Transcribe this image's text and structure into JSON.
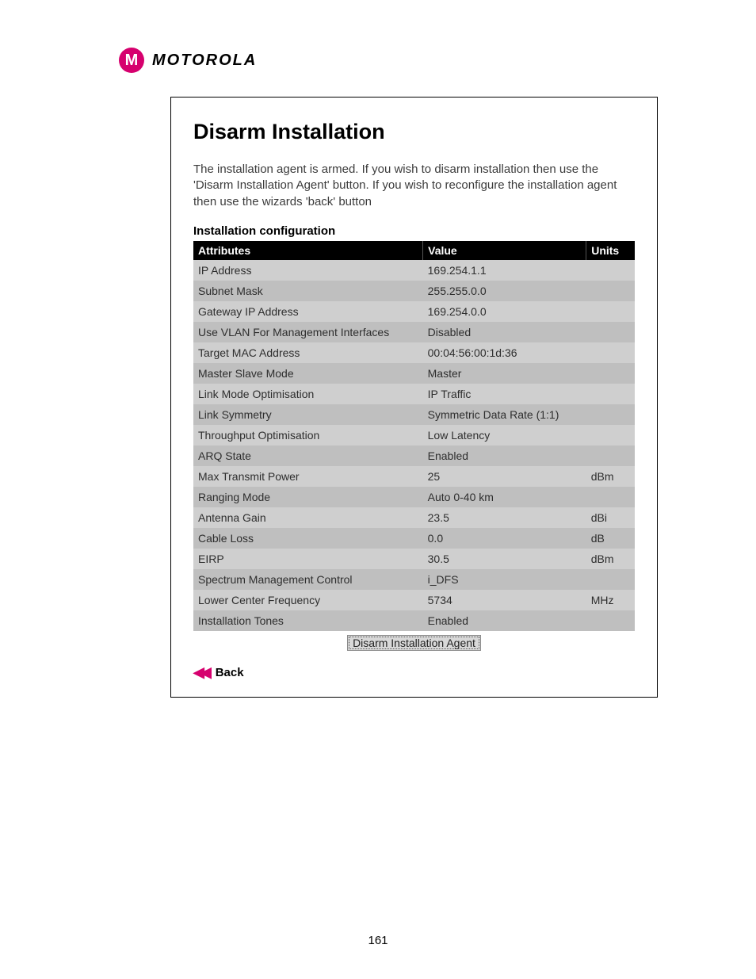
{
  "brand": "MOTOROLA",
  "logo_letter": "M",
  "page_title": "Disarm Installation",
  "intro_text": "The installation agent is armed. If you wish to disarm installation then use the 'Disarm Installation Agent' button. If you wish to reconfigure the installation agent then use the wizards 'back' button",
  "section_title": "Installation configuration",
  "table": {
    "headers": {
      "attr": "Attributes",
      "value": "Value",
      "units": "Units"
    },
    "rows": [
      {
        "attr": "IP Address",
        "value": "169.254.1.1",
        "units": ""
      },
      {
        "attr": "Subnet Mask",
        "value": "255.255.0.0",
        "units": ""
      },
      {
        "attr": "Gateway IP Address",
        "value": "169.254.0.0",
        "units": ""
      },
      {
        "attr": "Use VLAN For Management Interfaces",
        "value": "Disabled",
        "units": ""
      },
      {
        "attr": "Target MAC Address",
        "value": "00:04:56:00:1d:36",
        "units": ""
      },
      {
        "attr": "Master Slave Mode",
        "value": "Master",
        "units": ""
      },
      {
        "attr": "Link Mode Optimisation",
        "value": "IP Traffic",
        "units": ""
      },
      {
        "attr": "Link Symmetry",
        "value": "Symmetric Data Rate (1:1)",
        "units": ""
      },
      {
        "attr": "Throughput Optimisation",
        "value": "Low Latency",
        "units": ""
      },
      {
        "attr": "ARQ State",
        "value": "Enabled",
        "units": ""
      },
      {
        "attr": "Max Transmit Power",
        "value": "25",
        "units": "dBm"
      },
      {
        "attr": "Ranging Mode",
        "value": "Auto 0-40 km",
        "units": ""
      },
      {
        "attr": "Antenna Gain",
        "value": "23.5",
        "units": "dBi"
      },
      {
        "attr": "Cable Loss",
        "value": "0.0",
        "units": "dB"
      },
      {
        "attr": "EIRP",
        "value": "30.5",
        "units": "dBm"
      },
      {
        "attr": "Spectrum Management Control",
        "value": "i_DFS",
        "units": ""
      },
      {
        "attr": "Lower Center Frequency",
        "value": "5734",
        "units": "MHz"
      },
      {
        "attr": "Installation Tones",
        "value": "Enabled",
        "units": ""
      }
    ]
  },
  "disarm_button_label": "Disarm Installation Agent",
  "back_label": "Back",
  "page_number": "161"
}
